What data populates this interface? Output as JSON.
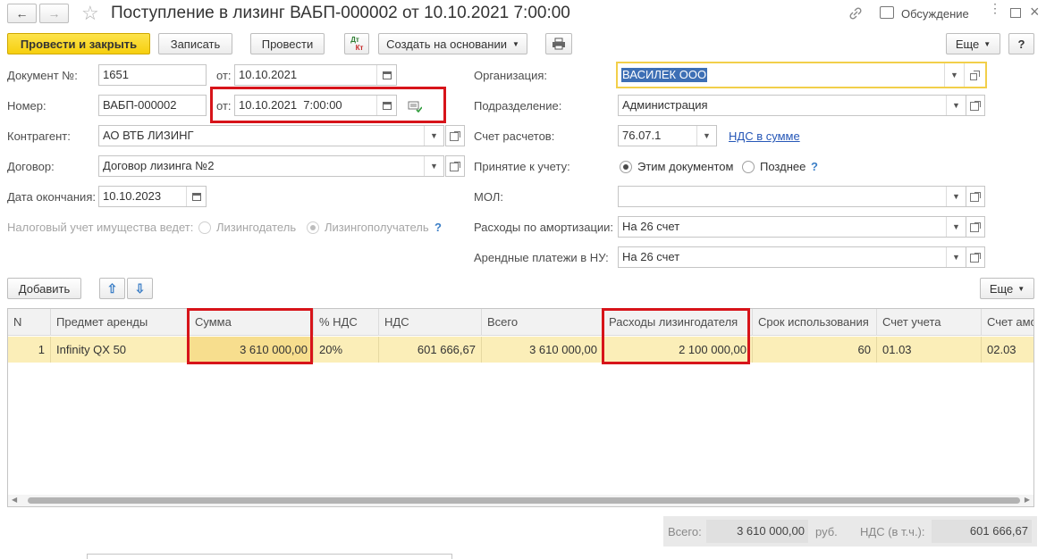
{
  "window": {
    "title": "Поступление в лизинг ВАБП-000002 от 10.10.2021 7:00:00",
    "discussion_label": "Обсуждение"
  },
  "toolbar": {
    "post_close_label": "Провести и закрыть",
    "save_label": "Записать",
    "post_label": "Провести",
    "dtkt_top": "Дт",
    "dtkt_bottom": "Кт",
    "create_based_label": "Создать на основании",
    "more_label": "Еще",
    "help_label": "?"
  },
  "form": {
    "doc_number_label": "Документ №:",
    "doc_number_value": "1651",
    "from_label": "от:",
    "doc_date_value": "10.10.2021",
    "number_label": "Номер:",
    "number_value": "ВАБП-000002",
    "number_from_label": "от:",
    "number_date_value": "10.10.2021  7:00:00",
    "counterparty_label": "Контрагент:",
    "counterparty_value": "АО ВТБ ЛИЗИНГ",
    "contract_label": "Договор:",
    "contract_value": "Договор лизинга №2",
    "end_date_label": "Дата окончания:",
    "end_date_value": "10.10.2023",
    "tax_label": "Налоговый учет имущества ведет:",
    "tax_option_lessor": "Лизингодатель",
    "tax_option_lessee": "Лизингополучатель",
    "question": "?",
    "org_label": "Организация:",
    "org_value": "ВАСИЛЕК ООО",
    "dept_label": "Подразделение:",
    "dept_value": "Администрация",
    "account_label": "Счет расчетов:",
    "account_value": "76.07.1",
    "vat_link": "НДС в сумме",
    "acceptance_label": "Принятие к учету:",
    "acceptance_option_this": "Этим документом",
    "acceptance_option_later": "Позднее",
    "mol_label": "МОЛ:",
    "mol_value": "",
    "amort_label": "Расходы по амортизации:",
    "amort_value": "На 26 счет",
    "rent_label": "Арендные платежи в НУ:",
    "rent_value": "На 26 счет"
  },
  "table_toolbar": {
    "add_label": "Добавить",
    "more_label": "Еще"
  },
  "table": {
    "headers": [
      "N",
      "Предмет аренды",
      "Сумма",
      "% НДС",
      "НДС",
      "Всего",
      "Расходы лизингодателя",
      "Срок использования",
      "Счет учета",
      "Счет амо"
    ],
    "rows": [
      [
        "1",
        "Infinity QX 50",
        "3 610 000,00",
        "20%",
        "601 666,67",
        "3 610 000,00",
        "2 100 000,00",
        "60",
        "01.03",
        "02.03"
      ]
    ]
  },
  "totals": {
    "total_label": "Всего:",
    "total_value": "3 610 000,00",
    "currency": "руб.",
    "vat_label": "НДС (в т.ч.):",
    "vat_value": "601 666,67"
  },
  "colors": {
    "highlight_red": "#d7141a",
    "primary_button": "#f6cf0e",
    "selected_row": "#fbeeb8"
  }
}
